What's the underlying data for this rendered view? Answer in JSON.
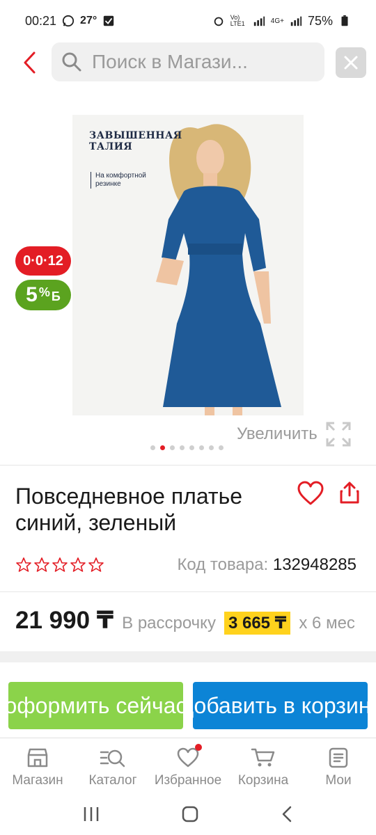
{
  "status_bar": {
    "time": "00:21",
    "temperature": "27°",
    "network": "4G+",
    "volte": "Vo) LTE1",
    "battery": "75%"
  },
  "search": {
    "placeholder": "Поиск в Магази..."
  },
  "product_image": {
    "headline": "ЗАВЫШЕННАЯ ТАЛИЯ",
    "note": "На комфортной резинке",
    "dress_color": "#1f5a97"
  },
  "badges": {
    "installment_badge": "0·0·12",
    "bonus_percent": "5",
    "bonus_percent_sign": "%",
    "bonus_currency": "Б"
  },
  "gallery": {
    "zoom_label": "Увеличить",
    "dot_count": 8,
    "active_dot": 1
  },
  "product": {
    "title": "Повседневное платье синий, зеленый",
    "rating_stars": 0,
    "code_label": "Код товара:",
    "code_value": "132948285",
    "price": "21 990 ₸",
    "installment_label": "В рассрочку",
    "installment_value": "3 665 ₸",
    "installment_term": "х 6 мес"
  },
  "actions": {
    "checkout_label": "оформить сейчас",
    "add_to_cart_label": "Добавить в корзину"
  },
  "bottom_nav": {
    "items": [
      {
        "label": "Магазин",
        "icon": "store-icon"
      },
      {
        "label": "Каталог",
        "icon": "catalog-search-icon"
      },
      {
        "label": "Избранное",
        "icon": "heart-icon"
      },
      {
        "label": "Корзина",
        "icon": "cart-icon"
      },
      {
        "label": "Мои",
        "icon": "orders-icon"
      }
    ]
  },
  "colors": {
    "accent_red": "#e31d25",
    "checkout_green": "#8bd34a",
    "cart_blue": "#0c84d6",
    "installment_yellow": "#ffd21d",
    "bonus_green": "#5ba31f"
  }
}
